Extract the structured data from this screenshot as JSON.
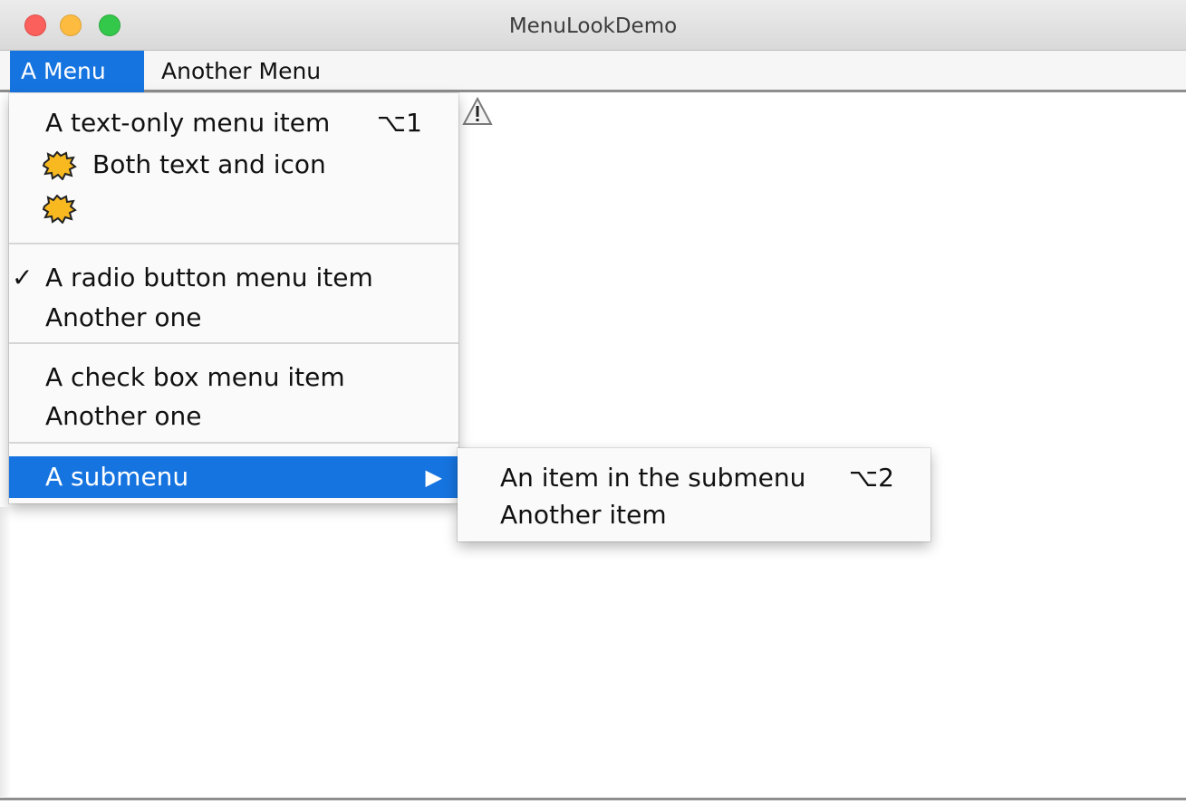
{
  "window": {
    "title": "MenuLookDemo"
  },
  "menubar": {
    "menus": [
      {
        "label": "A Menu",
        "active": true
      },
      {
        "label": "Another Menu",
        "active": false
      }
    ]
  },
  "popup": {
    "items": [
      {
        "label": "A text-only menu item",
        "accelerator": "⌥1"
      },
      {
        "label": "Both text and icon",
        "icon": "starburst-icon"
      },
      {
        "label": "",
        "icon": "starburst-icon"
      },
      {
        "label": "A radio button menu item",
        "checked": true
      },
      {
        "label": "Another one"
      },
      {
        "label": "A check box menu item"
      },
      {
        "label": "Another one"
      },
      {
        "label": "A submenu",
        "submenu_arrow": "▶",
        "selected": true
      }
    ]
  },
  "submenu": {
    "items": [
      {
        "label": "An item in the submenu",
        "accelerator": "⌥2"
      },
      {
        "label": "Another item"
      }
    ]
  },
  "colors": {
    "selection": "#1674e0",
    "traffic_close": "#fc605c",
    "traffic_minimize": "#fdbc40",
    "traffic_maximize": "#34c84a"
  },
  "icons": {
    "checkmark": "✓",
    "content_icon": "warning-icon"
  }
}
